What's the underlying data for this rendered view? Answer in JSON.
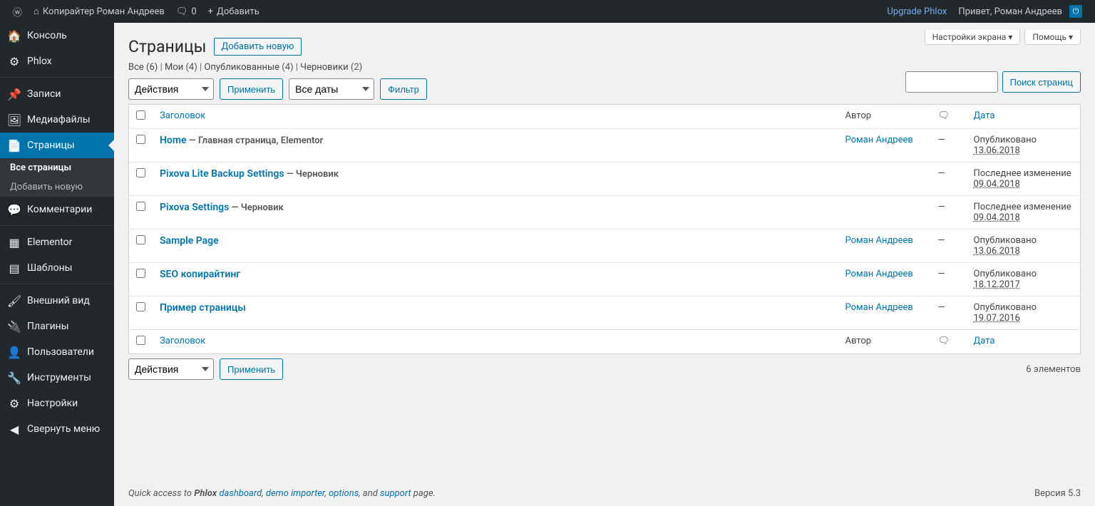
{
  "adminbar": {
    "site_name": "Копирайтер Роман Андреев",
    "comments_count": "0",
    "add_new": "Добавить",
    "upgrade": "Upgrade Phlox",
    "greeting": "Привет, Роман Андреев"
  },
  "sidebar": {
    "items": [
      {
        "label": "Консоль",
        "icon": "🏠"
      },
      {
        "label": "Phlox",
        "icon": "⚙"
      },
      {
        "label": "Записи",
        "icon": "📌"
      },
      {
        "label": "Медиафайлы",
        "icon": "🖼"
      },
      {
        "label": "Страницы",
        "icon": "📄",
        "current": true
      },
      {
        "label": "Комментарии",
        "icon": "💬"
      },
      {
        "label": "Elementor",
        "icon": "▦"
      },
      {
        "label": "Шаблоны",
        "icon": "▤"
      },
      {
        "label": "Внешний вид",
        "icon": "🖌"
      },
      {
        "label": "Плагины",
        "icon": "🔌"
      },
      {
        "label": "Пользователи",
        "icon": "👤"
      },
      {
        "label": "Инструменты",
        "icon": "🔧"
      },
      {
        "label": "Настройки",
        "icon": "⚙"
      },
      {
        "label": "Свернуть меню",
        "icon": "◀"
      }
    ],
    "submenu": {
      "all": "Все страницы",
      "add": "Добавить новую"
    }
  },
  "screen": {
    "options": "Настройки экрана",
    "help": "Помощь"
  },
  "page": {
    "title": "Страницы",
    "add_new": "Добавить новую"
  },
  "filters": {
    "all_label": "Все",
    "all_count": "(6)",
    "mine_label": "Мои",
    "mine_count": "(4)",
    "published_label": "Опубликованные",
    "published_count": "(4)",
    "drafts_label": "Черновики",
    "drafts_count": "(2)"
  },
  "bulk": {
    "action_label": "Действия",
    "apply": "Применить",
    "all_dates": "Все даты",
    "filter": "Фильтр"
  },
  "search": {
    "button": "Поиск страниц"
  },
  "count_text": "6 элементов",
  "table": {
    "headers": {
      "title": "Заголовок",
      "author": "Автор",
      "date": "Дата"
    },
    "rows": [
      {
        "title": "Home",
        "state": " — Главная страница, Elementor",
        "author": "Роман Андреев",
        "comments": "—",
        "date_status": "Опубликовано",
        "date": "13.06.2018"
      },
      {
        "title": "Pixova Lite Backup Settings",
        "state": " — Черновик",
        "author": "",
        "comments": "—",
        "date_status": "Последнее изменение",
        "date": "09.04.2018"
      },
      {
        "title": "Pixova Settings",
        "state": " — Черновик",
        "author": "",
        "comments": "—",
        "date_status": "Последнее изменение",
        "date": "09.04.2018"
      },
      {
        "title": "Sample Page",
        "state": "",
        "author": "Роман Андреев",
        "comments": "—",
        "date_status": "Опубликовано",
        "date": "13.06.2018"
      },
      {
        "title": "SEO копирайтинг",
        "state": "",
        "author": "Роман Андреев",
        "comments": "—",
        "date_status": "Опубликовано",
        "date": "18.12.2017"
      },
      {
        "title": "Пример страницы",
        "state": "",
        "author": "Роман Андреев",
        "comments": "—",
        "date_status": "Опубликовано",
        "date": "19.07.2016"
      }
    ]
  },
  "footer": {
    "prefix": "Quick access to ",
    "brand": "Phlox ",
    "dashboard": "dashboard",
    "demo": "demo importer",
    "options": "options",
    "and": ", and ",
    "support": "support",
    "suffix": " page.",
    "version": "Версия 5.3"
  }
}
